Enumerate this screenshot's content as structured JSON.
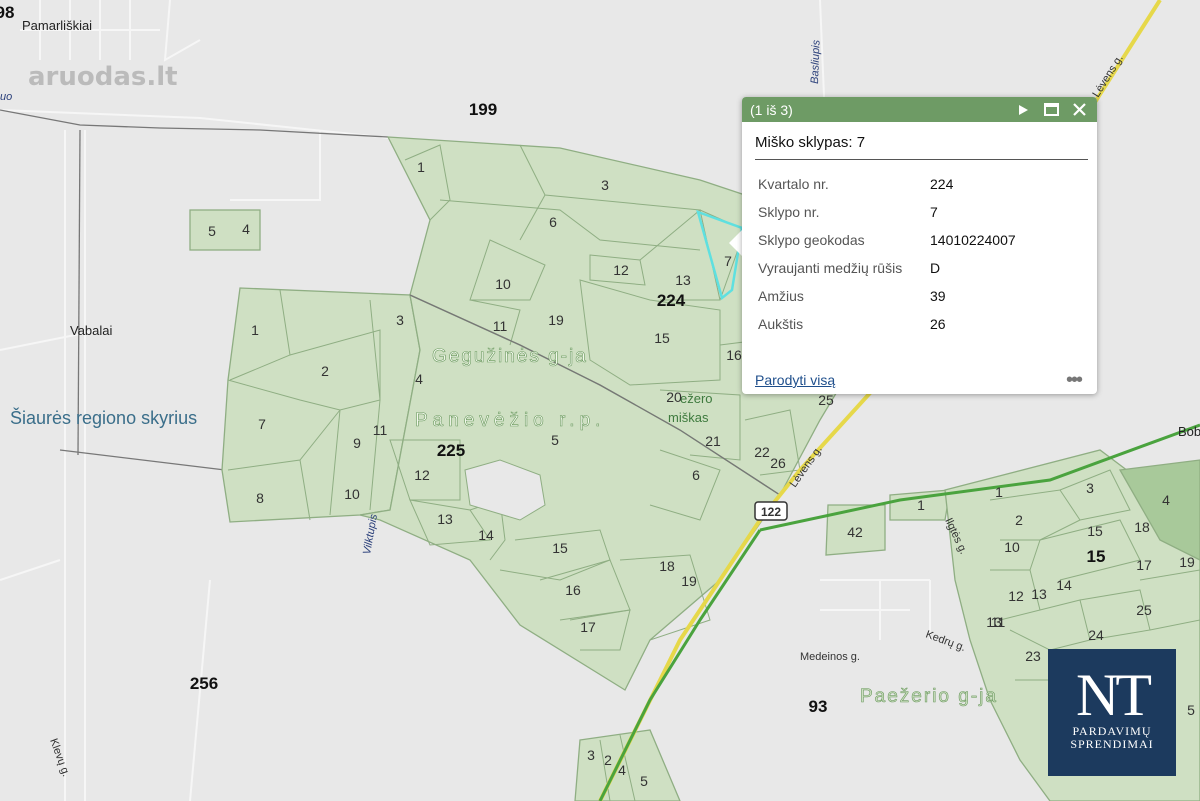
{
  "watermark": "aruodas.lt",
  "places": {
    "pamarliskiai": "Pamarliškiai",
    "vabalai": "Vabalai",
    "region_office": "Šiaurės regiono skyrius",
    "gegužines": "Gegužinės g-ja",
    "panevezio": "Panevėžio r.p.",
    "paezerio": "Paežerio g-ja",
    "ezero_miskas_1": "ežero",
    "ezero_miskas_2": "miškas",
    "bob": "Bob"
  },
  "streets": {
    "basliupis": "Basliupis",
    "levens_top": "Lėvens g.",
    "levens": "Lėvens g.",
    "vilktupis": "Vilktupis",
    "medeinos": "Medeinos g.",
    "kedru": "Kedrų g.",
    "ligtes": "Ilgtės g.",
    "klevu": "Klevų g.",
    "uo": "uo",
    "road_122": "122"
  },
  "quarters": {
    "q98": "98",
    "q199": "199",
    "q224": "224",
    "q225": "225",
    "q256": "256",
    "q93": "93",
    "q15": "15"
  },
  "plots": [
    "1",
    "3",
    "6",
    "5",
    "4",
    "10",
    "11",
    "19",
    "12",
    "13",
    "7",
    "15",
    "16",
    "20",
    "21",
    "22",
    "26",
    "25",
    "2",
    "1",
    "7",
    "9",
    "11",
    "3",
    "4",
    "8",
    "10",
    "12",
    "13",
    "14",
    "5",
    "6",
    "15",
    "16",
    "17",
    "18",
    "19",
    "42",
    "1",
    "1",
    "3",
    "2",
    "15",
    "18",
    "10",
    "13",
    "14",
    "17",
    "12",
    "13",
    "11",
    "25",
    "23",
    "24",
    "19",
    "5",
    "4",
    "3",
    "2",
    "4",
    "5"
  ],
  "popup": {
    "pager": "(1 iš 3)",
    "title": "Miško sklypas: 7",
    "rows": [
      {
        "key": "Kvartalo nr.",
        "value": "224"
      },
      {
        "key": "Sklypo nr.",
        "value": "7"
      },
      {
        "key": "Sklypo geokodas",
        "value": "14010224007"
      },
      {
        "key": "Vyraujanti medžių rūšis",
        "value": "D"
      },
      {
        "key": "Amžius",
        "value": "39"
      },
      {
        "key": "Aukštis",
        "value": "26"
      }
    ],
    "show_all": "Parodyti visą",
    "more": "•••",
    "icons": [
      "play-icon",
      "maximize-icon",
      "close-icon"
    ]
  },
  "logo": {
    "mark": "NT",
    "line1": "PARDAVIMŲ",
    "line2": "SPRENDIMAI"
  },
  "colors": {
    "forest": "#cfe0c3",
    "forest_border": "#8fae83",
    "background": "#e8e8e8",
    "popup_header": "#6e9b65",
    "highlight": "#5fe0e0",
    "road_yellow": "#e6d84a",
    "boundary_green": "#4aa33e",
    "logo_bg": "#1c3a5e"
  }
}
